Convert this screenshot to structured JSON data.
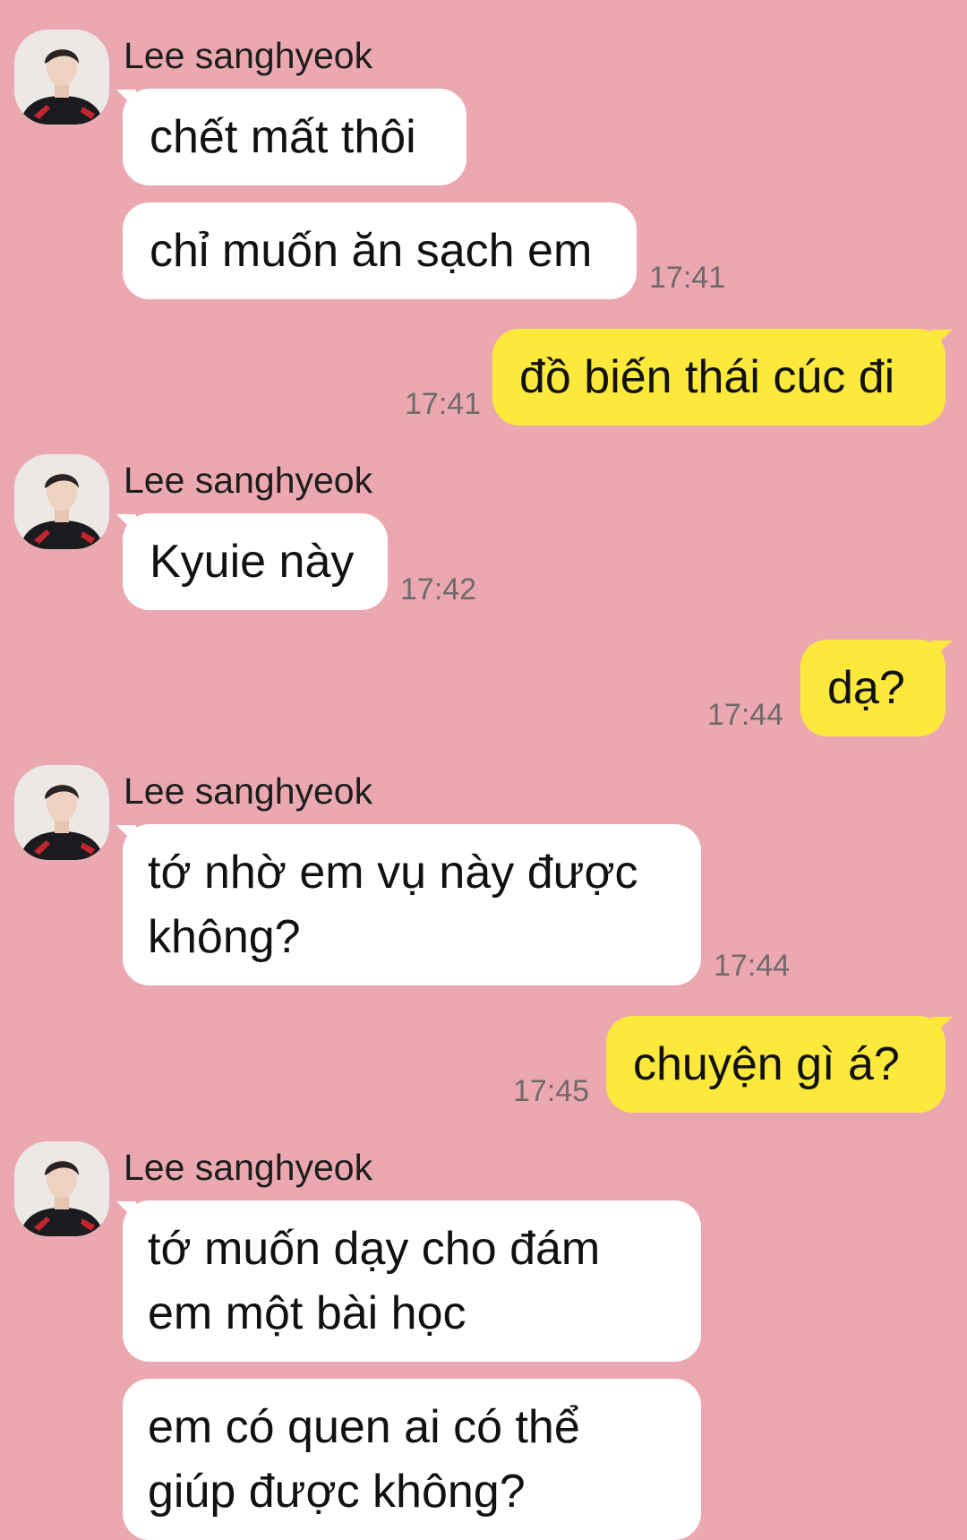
{
  "colors": {
    "background": "#eba8b0",
    "incoming_bubble": "#ffffff",
    "outgoing_bubble": "#fde93c",
    "timestamp": "#6f6a6b"
  },
  "chat": {
    "groups": [
      {
        "sender": "Lee sanghyeok",
        "avatar_icon": "profile-photo",
        "messages": [
          "chết mất thôi",
          "chỉ muốn ăn sạch em"
        ],
        "time": "17:41"
      },
      {
        "outgoing": "đồ biến thái cúc đi",
        "time": "17:41"
      },
      {
        "sender": "Lee sanghyeok",
        "avatar_icon": "profile-photo",
        "messages": [
          "Kyuie này"
        ],
        "time": "17:42"
      },
      {
        "outgoing": "dạ?",
        "time": "17:44"
      },
      {
        "sender": "Lee sanghyeok",
        "avatar_icon": "profile-photo",
        "messages": [
          [
            "tớ nhờ em vụ này được",
            "không?"
          ]
        ],
        "time": "17:44"
      },
      {
        "outgoing": "chuyện gì á?",
        "time": "17:45"
      },
      {
        "sender": "Lee sanghyeok",
        "avatar_icon": "profile-photo",
        "messages": [
          [
            "tớ muốn dạy cho đám",
            "em một bài học"
          ],
          [
            "em có quen ai có thể",
            "giúp được không?"
          ]
        ]
      }
    ]
  }
}
